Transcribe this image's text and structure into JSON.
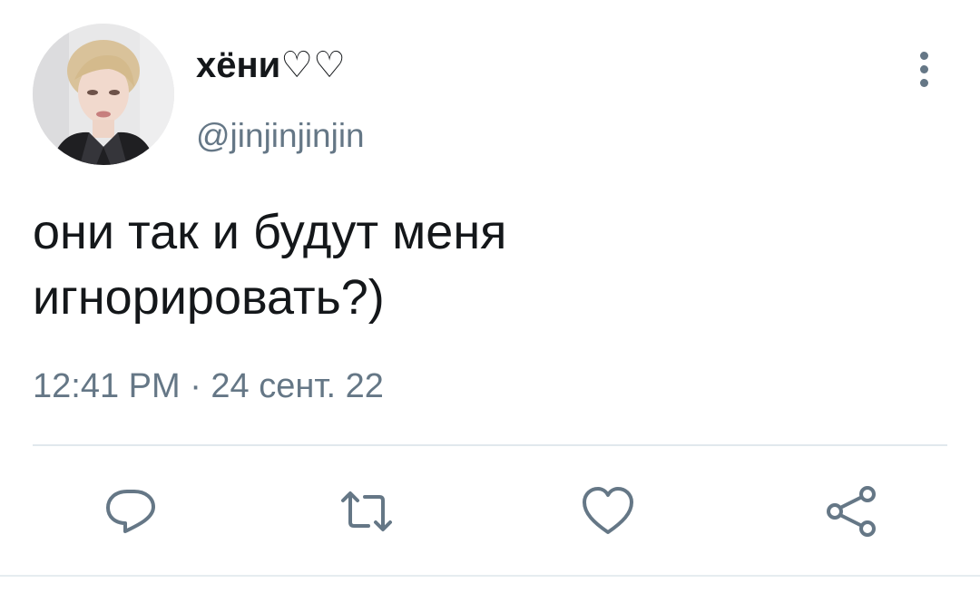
{
  "tweet": {
    "display_name": "хёни♡♡",
    "handle": "@jinjinjinjin",
    "text_lines": [
      "они так и будут меня",
      "игнорировать?)"
    ],
    "timestamp": "12:41 PM · 24 сент. 22"
  },
  "icons": {
    "more": "more-vertical-icon",
    "reply": "reply-icon",
    "retweet": "retweet-icon",
    "like": "heart-icon",
    "share": "share-icon"
  },
  "colors": {
    "text": "#14171a",
    "secondary": "#657786",
    "divider": "#e1e8ed"
  }
}
